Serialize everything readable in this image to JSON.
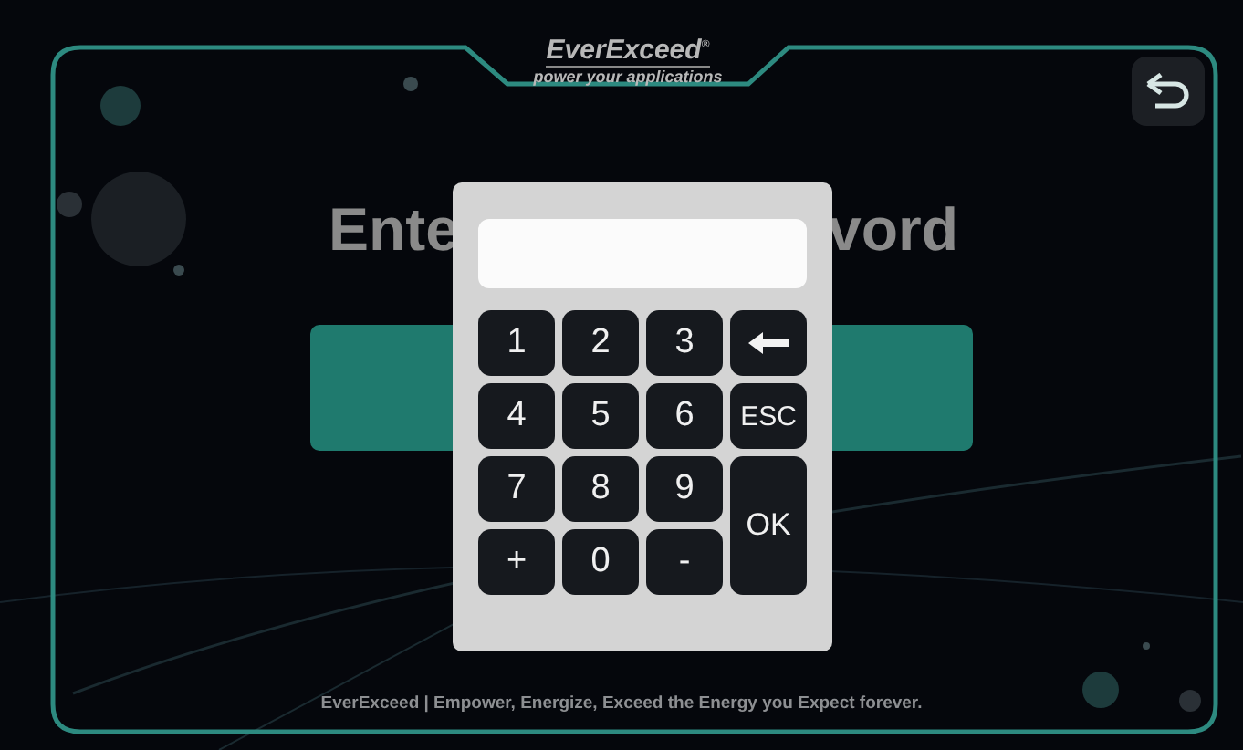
{
  "header": {
    "brand": "EverExceed",
    "brand_mark": "®",
    "tagline": "power your applications"
  },
  "title": {
    "left_part": "Ente",
    "right_part": "vord"
  },
  "keypad": {
    "keys": [
      {
        "kind": "key",
        "label": "1"
      },
      {
        "kind": "key",
        "label": "2"
      },
      {
        "kind": "key",
        "label": "3"
      },
      {
        "kind": "backspace"
      },
      {
        "kind": "key",
        "label": "4"
      },
      {
        "kind": "key",
        "label": "5"
      },
      {
        "kind": "key",
        "label": "6"
      },
      {
        "kind": "key",
        "label": "ESC"
      },
      {
        "kind": "key",
        "label": "7"
      },
      {
        "kind": "key",
        "label": "8"
      },
      {
        "kind": "key",
        "label": "9"
      },
      {
        "kind": "tall",
        "label": "OK"
      },
      {
        "kind": "key",
        "label": "+"
      },
      {
        "kind": "key",
        "label": "0"
      },
      {
        "kind": "key",
        "label": "-"
      }
    ]
  },
  "footer": "EverExceed | Empower, Energize, Exceed the Energy you Expect forever."
}
